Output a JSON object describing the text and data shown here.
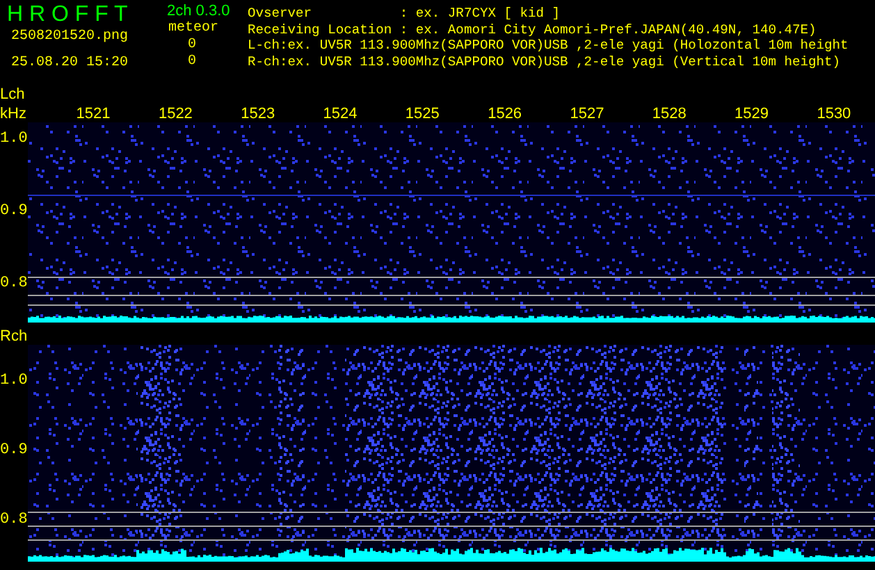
{
  "header": {
    "app_name": "H R O F F T",
    "file_name": "2508201520.png",
    "timestamp": "25.08.20 15:20",
    "version": "2ch 0.3.0",
    "counter_label": "meteor",
    "counts": [
      "0",
      "0"
    ],
    "info_lines": [
      "Ovserver           : ex. JR7CYX [ kid ]",
      "Receiving Location : ex. Aomori City Aomori-Pref.JAPAN(40.49N, 140.47E)",
      "L-ch:ex. UV5R 113.900Mhz(SAPPORO VOR)USB ,2-ele yagi (Holozontal 10m height",
      "R-ch:ex. UV5R 113.900Mhz(SAPPORO VOR)USB ,2-ele yagi (Vertical 10m height)"
    ]
  },
  "frequency_unit": "kHz",
  "frequency_labels": [
    "1521",
    "1522",
    "1523",
    "1524",
    "1525",
    "1526",
    "1527",
    "1528",
    "1529",
    "1530"
  ],
  "channels": [
    {
      "name": "Lch",
      "kind": "quiet",
      "y_labels": [
        "1.0",
        "0.9",
        "0.8"
      ]
    },
    {
      "name": "Rch",
      "kind": "active",
      "y_labels": [
        "1.0",
        "0.9",
        "0.8"
      ]
    }
  ]
}
